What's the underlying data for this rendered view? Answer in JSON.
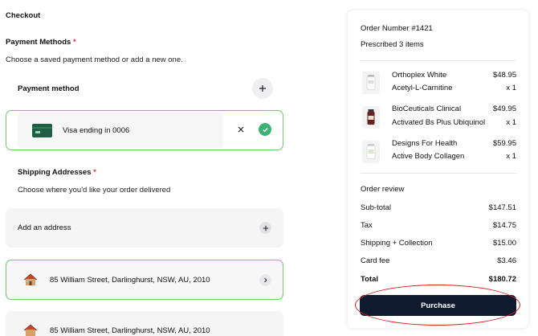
{
  "checkout_title": "Checkout",
  "payment": {
    "heading": "Payment Methods",
    "required_mark": "*",
    "subtitle": "Choose a saved payment method or add a new one.",
    "method_label": "Payment method",
    "selected_card": "Visa ending in 0006"
  },
  "shipping": {
    "heading": "Shipping Addresses",
    "required_mark": "*",
    "subtitle": "Choose where you'd like your order delivered",
    "add_label": "Add an address",
    "addresses": [
      "85 William Street, Darlinghurst, NSW, AU, 2010",
      "85 William Street, Darlinghurst, NSW, AU, 2010"
    ]
  },
  "order": {
    "number": "Order Number #1421",
    "prescribed": "Prescribed 3 items",
    "items": [
      {
        "brand": "Orthoplex White",
        "name": "Acetyl-L-Carnitine",
        "price": "$48.95",
        "qty": "x 1"
      },
      {
        "brand": "BioCeuticals Clinical",
        "name": "Activated Bs Plus Ubiquinol",
        "price": "$49.95",
        "qty": "x 1"
      },
      {
        "brand": "Designs For Health",
        "name": "Active Body Collagen",
        "price": "$59.95",
        "qty": "x 1"
      }
    ],
    "review_heading": "Order review",
    "summary": [
      {
        "label": "Sub-total",
        "value": "$147.51"
      },
      {
        "label": "Tax",
        "value": "$14.75"
      },
      {
        "label": "Shipping + Collection",
        "value": "$15.00"
      },
      {
        "label": "Card fee",
        "value": "$3.46"
      },
      {
        "label": "Total",
        "value": "$180.72"
      }
    ],
    "purchase_label": "Purchase"
  },
  "colors": {
    "accent_green": "#6fc96e",
    "check_green": "#3bb273",
    "purchase_bg": "#0f1a2e",
    "required_red": "#e0342b",
    "highlight_red": "#d92020"
  }
}
